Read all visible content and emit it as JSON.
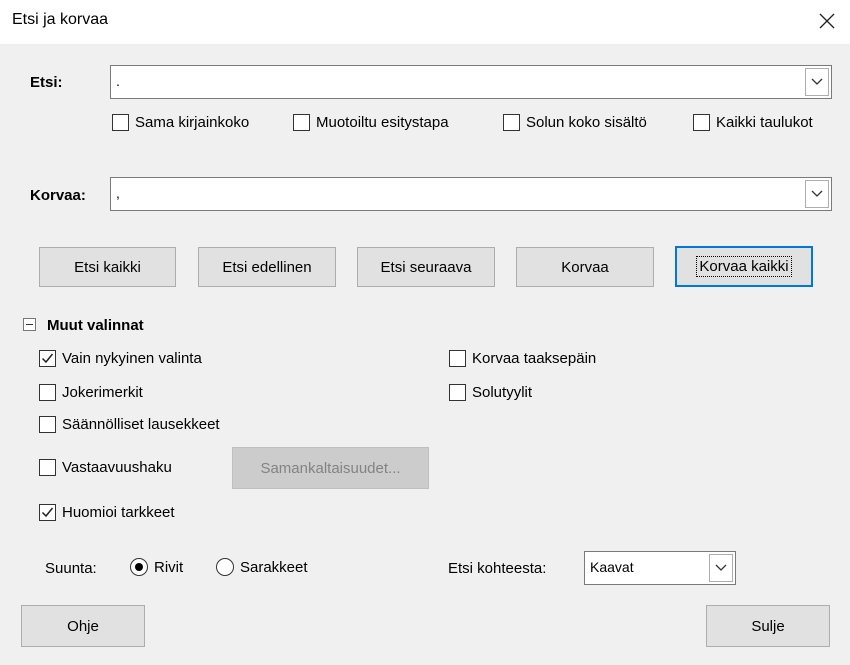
{
  "window": {
    "title": "Etsi ja korvaa"
  },
  "search": {
    "label": "Etsi:",
    "value": "."
  },
  "replace": {
    "label": "Korvaa:",
    "value": ","
  },
  "search_options": [
    {
      "label": "Sama kirjainkoko",
      "checked": false
    },
    {
      "label": "Muotoiltu esitystapa",
      "checked": false
    },
    {
      "label": "Solun koko sisältö",
      "checked": false
    },
    {
      "label": "Kaikki taulukot",
      "checked": false
    }
  ],
  "buttons": {
    "find_all": "Etsi kaikki",
    "find_previous": "Etsi edellinen",
    "find_next": "Etsi seuraava",
    "replace": "Korvaa",
    "replace_all": "Korvaa kaikki",
    "similarities": "Samankaltaisuudet...",
    "help": "Ohje",
    "close": "Sulje"
  },
  "other_options": {
    "header": "Muut valinnat",
    "current_selection_only": {
      "label": "Vain nykyinen valinta",
      "checked": true
    },
    "replace_backwards": {
      "label": "Korvaa taaksepäin",
      "checked": false
    },
    "wildcards": {
      "label": "Jokerimerkit",
      "checked": false
    },
    "cell_styles": {
      "label": "Solutyylit",
      "checked": false
    },
    "regex": {
      "label": "Säännölliset lausekkeet",
      "checked": false
    },
    "similarity": {
      "label": "Vastaavuushaku",
      "checked": false
    },
    "diacritics": {
      "label": "Huomioi tarkkeet",
      "checked": true
    }
  },
  "direction": {
    "label": "Suunta:",
    "rows": {
      "label": "Rivit",
      "selected": true
    },
    "columns": {
      "label": "Sarakkeet",
      "selected": false
    }
  },
  "search_in": {
    "label": "Etsi kohteesta:",
    "value": "Kaavat"
  }
}
